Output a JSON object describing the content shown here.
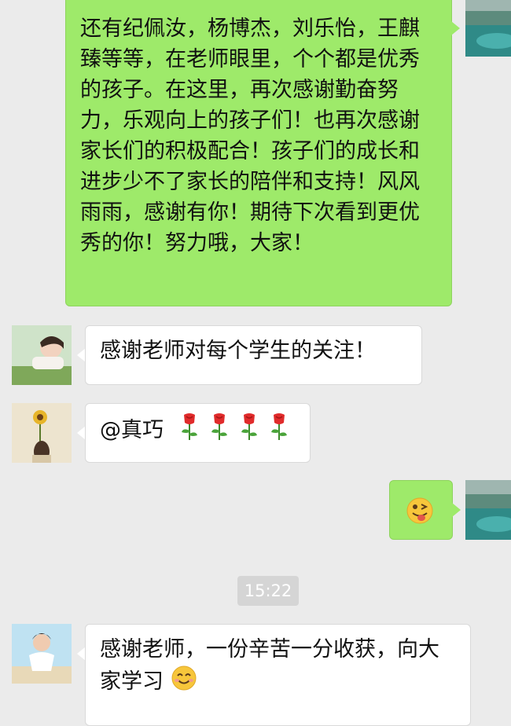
{
  "messages": [
    {
      "direction": "out",
      "text": "还有纪佩汝，杨博杰，刘乐怡，王麒臻等等，在老师眼里，个个都是优秀的孩子。在这里，再次感谢勤奋努力，乐观向上的孩子们！也再次感谢家长们的积极配合！孩子们的成长和进步少不了家长的陪伴和支持！风风雨雨，感谢有你！期待下次看到更优秀的你！努力哦，大家！"
    },
    {
      "direction": "in",
      "text": "感谢老师对每个学生的关注！"
    },
    {
      "direction": "in",
      "text": "@真巧",
      "trailing_icons": [
        "rose-icon",
        "rose-icon",
        "rose-icon",
        "rose-icon"
      ]
    },
    {
      "direction": "out",
      "icon": "winking-tongue-emoji-icon"
    },
    {
      "direction": "in",
      "text": "感谢老师，一份辛苦一分收获，向大家学习",
      "trailing_icon": "smiling-emoji-icon"
    }
  ],
  "timestamp": "15:22",
  "colors": {
    "background": "#ebebeb",
    "outgoing_bubble": "#9eea6a",
    "incoming_bubble": "#ffffff",
    "timestamp_badge": "#d5d5d5"
  }
}
